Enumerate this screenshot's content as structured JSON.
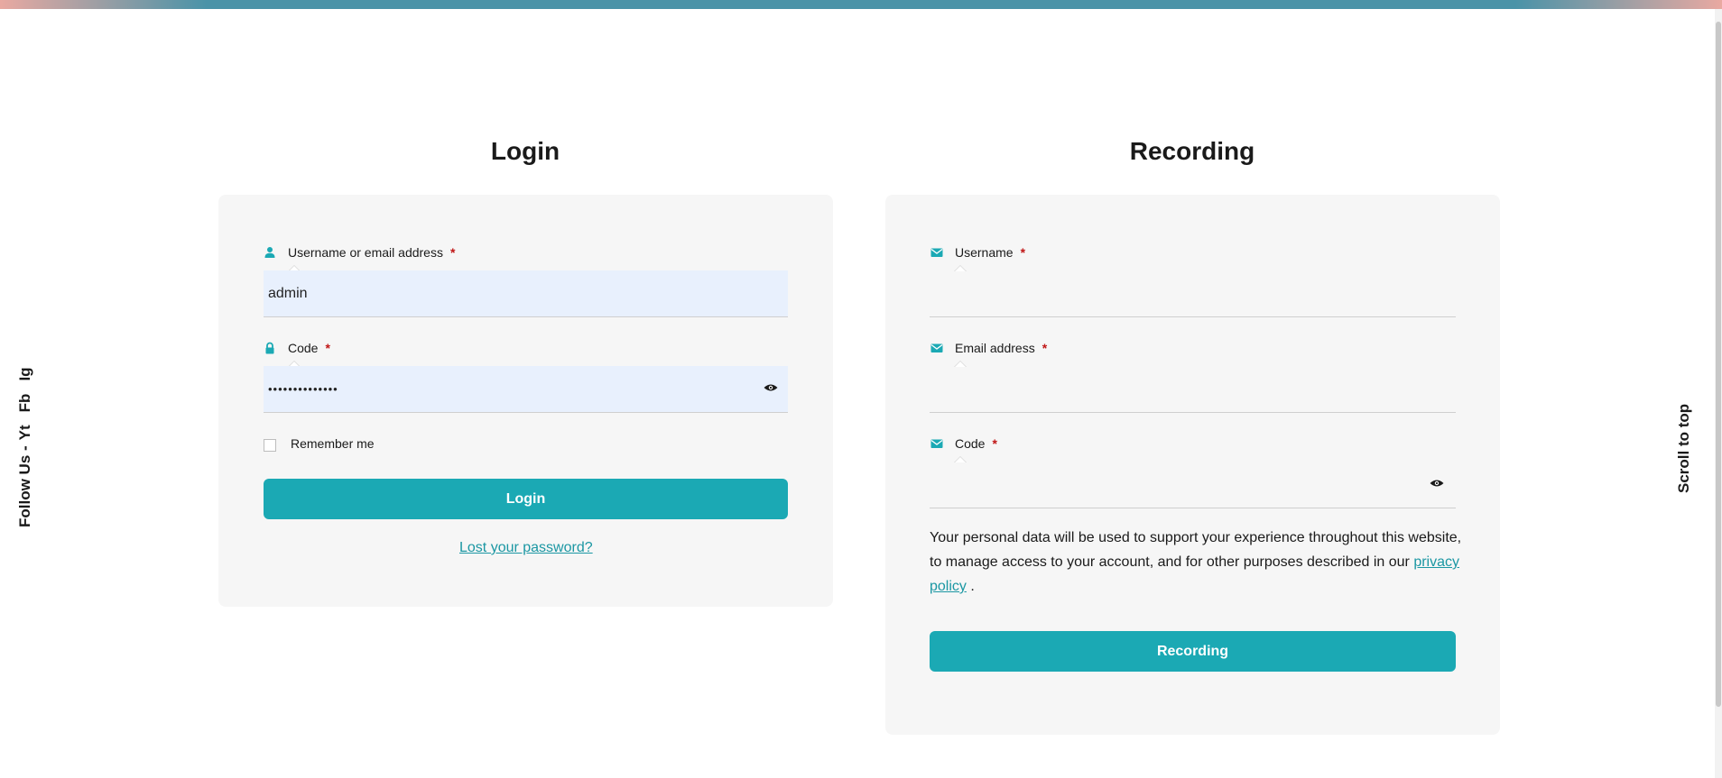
{
  "social": {
    "follow_label": "Follow Us -",
    "links": [
      "Yt",
      "Fb",
      "Ig"
    ]
  },
  "scroll_to_top": "Scroll to top",
  "login": {
    "title": "Login",
    "username_label": "Username or email address",
    "username_value": "admin",
    "password_label": "Code",
    "password_value": "••••••••••••••",
    "remember_label": "Remember me",
    "remember_checked": false,
    "submit_label": "Login",
    "lost_password": "Lost your password?"
  },
  "recording": {
    "title": "Recording",
    "username_label": "Username",
    "email_label": "Email address",
    "password_label": "Code",
    "privacy_text_before": "Your personal data will be used to support your experience throughout this website, to manage access to your account, and for other purposes described in our",
    "privacy_link": "privacy policy",
    "privacy_text_after": ".",
    "submit_label": "Recording"
  },
  "required_mark": "*",
  "colors": {
    "accent": "#1ba9b4",
    "link": "#1b97a3",
    "required": "#c01616",
    "card_bg": "#f6f6f6",
    "autofill_bg": "#e8f0fd"
  },
  "icons": {
    "user": "user-icon",
    "lock": "lock-icon",
    "envelope": "envelope-icon",
    "eye": "eye-icon"
  }
}
